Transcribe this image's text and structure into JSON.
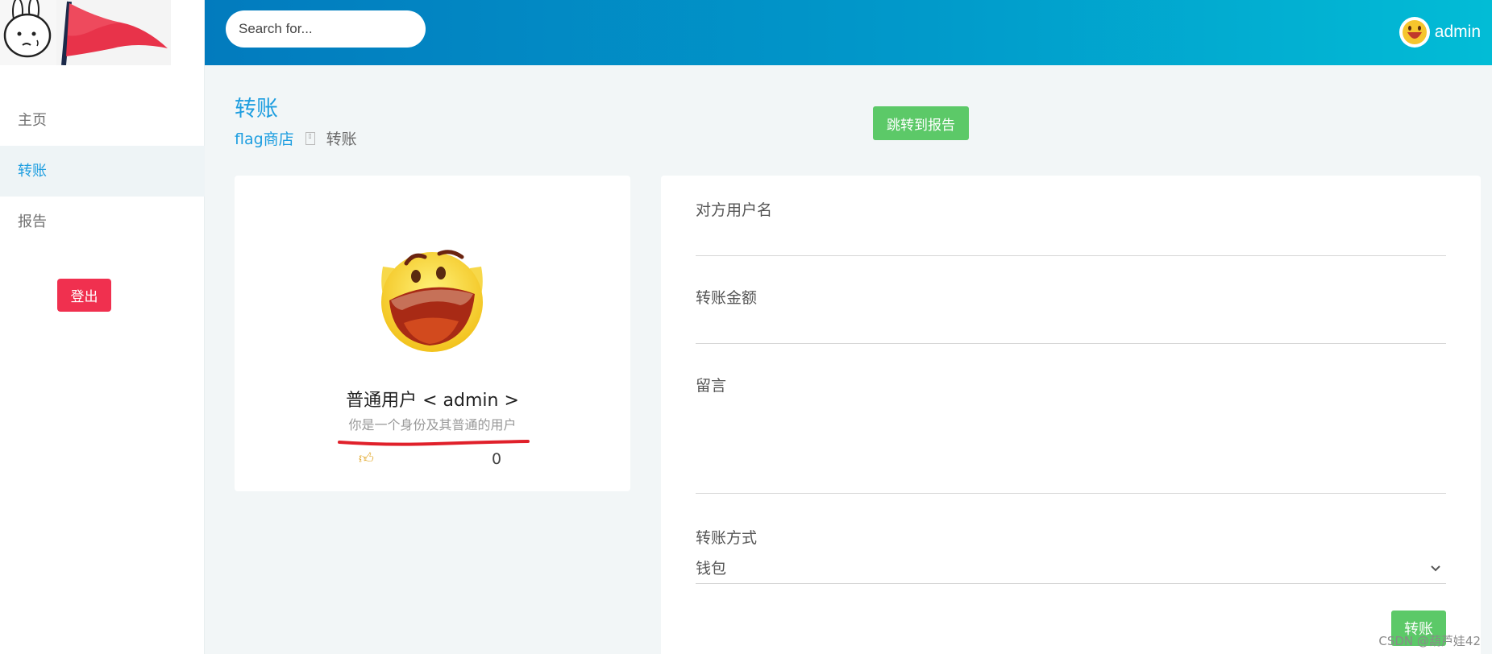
{
  "sidebar": {
    "items": [
      {
        "label": "主页"
      },
      {
        "label": "转账"
      },
      {
        "label": "报告"
      }
    ],
    "logout_label": "登出"
  },
  "header": {
    "search_placeholder": "Search for...",
    "username": "admin"
  },
  "page": {
    "title": "转账",
    "breadcrumb_root": "flag商店",
    "breadcrumb_current": "转账",
    "report_button": "跳转到报告"
  },
  "profile": {
    "name": "普通用户 < admin >",
    "description": "你是一个身份及其普通的用户",
    "likes": "0"
  },
  "form": {
    "recipient_label": "对方用户名",
    "amount_label": "转账金额",
    "message_label": "留言",
    "method_label": "转账方式",
    "method_value": "钱包",
    "submit_label": "转账"
  },
  "watermark": "CSDN @葫芦娃42",
  "colors": {
    "accent": "#1e9ee0",
    "header_start": "#027bbe",
    "header_end": "#02bcd6",
    "logout": "#f0304f",
    "success": "#5cc968"
  }
}
